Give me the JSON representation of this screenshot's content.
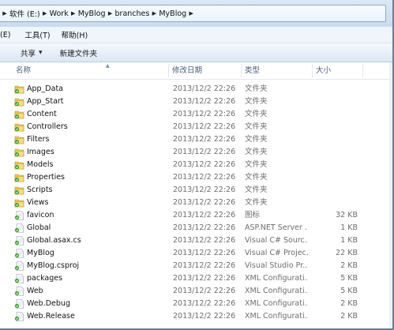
{
  "address_bar": {
    "crumbs": [
      "软件 (E:)",
      "Work",
      "MyBlog",
      "branches",
      "MyBlog"
    ]
  },
  "menu": {
    "items": [
      "(E)",
      "工具(T)",
      "帮助(H)"
    ]
  },
  "toolbar": {
    "share_label": "共享",
    "new_folder_label": "新建文件夹"
  },
  "columns": {
    "name": "名称",
    "date": "修改日期",
    "type": "类型",
    "size": "大小"
  },
  "files": [
    {
      "name": "App_Data",
      "date": "2013/12/2 22:26",
      "type": "文件夹",
      "size": "",
      "icon": "folder-icon"
    },
    {
      "name": "App_Start",
      "date": "2013/12/2 22:26",
      "type": "文件夹",
      "size": "",
      "icon": "folder-icon"
    },
    {
      "name": "Content",
      "date": "2013/12/2 22:26",
      "type": "文件夹",
      "size": "",
      "icon": "folder-icon"
    },
    {
      "name": "Controllers",
      "date": "2013/12/2 22:26",
      "type": "文件夹",
      "size": "",
      "icon": "folder-icon"
    },
    {
      "name": "Filters",
      "date": "2013/12/2 22:26",
      "type": "文件夹",
      "size": "",
      "icon": "folder-icon"
    },
    {
      "name": "Images",
      "date": "2013/12/2 22:26",
      "type": "文件夹",
      "size": "",
      "icon": "folder-icon"
    },
    {
      "name": "Models",
      "date": "2013/12/2 22:26",
      "type": "文件夹",
      "size": "",
      "icon": "folder-icon"
    },
    {
      "name": "Properties",
      "date": "2013/12/2 22:26",
      "type": "文件夹",
      "size": "",
      "icon": "folder-icon"
    },
    {
      "name": "Scripts",
      "date": "2013/12/2 22:26",
      "type": "文件夹",
      "size": "",
      "icon": "folder-icon"
    },
    {
      "name": "Views",
      "date": "2013/12/2 22:26",
      "type": "文件夹",
      "size": "",
      "icon": "folder-icon"
    },
    {
      "name": "favicon",
      "date": "2013/12/2 22:26",
      "type": "图标",
      "size": "32 KB",
      "icon": "file-icon"
    },
    {
      "name": "Global",
      "date": "2013/12/2 22:26",
      "type": "ASP.NET Server ...",
      "size": "1 KB",
      "icon": "file-icon"
    },
    {
      "name": "Global.asax.cs",
      "date": "2013/12/2 22:26",
      "type": "Visual C# Sourc...",
      "size": "1 KB",
      "icon": "file-icon"
    },
    {
      "name": "MyBlog",
      "date": "2013/12/2 22:26",
      "type": "Visual C# Projec...",
      "size": "22 KB",
      "icon": "file-icon"
    },
    {
      "name": "MyBlog.csproj",
      "date": "2013/12/2 22:26",
      "type": "Visual Studio Pr...",
      "size": "2 KB",
      "icon": "file-icon"
    },
    {
      "name": "packages",
      "date": "2013/12/2 22:26",
      "type": "XML Configurati...",
      "size": "5 KB",
      "icon": "file-icon"
    },
    {
      "name": "Web",
      "date": "2013/12/2 22:26",
      "type": "XML Configurati...",
      "size": "5 KB",
      "icon": "file-icon"
    },
    {
      "name": "Web.Debug",
      "date": "2013/12/2 22:26",
      "type": "XML Configurati...",
      "size": "2 KB",
      "icon": "file-icon"
    },
    {
      "name": "Web.Release",
      "date": "2013/12/2 22:26",
      "type": "XML Configurati...",
      "size": "2 KB",
      "icon": "file-icon"
    }
  ]
}
